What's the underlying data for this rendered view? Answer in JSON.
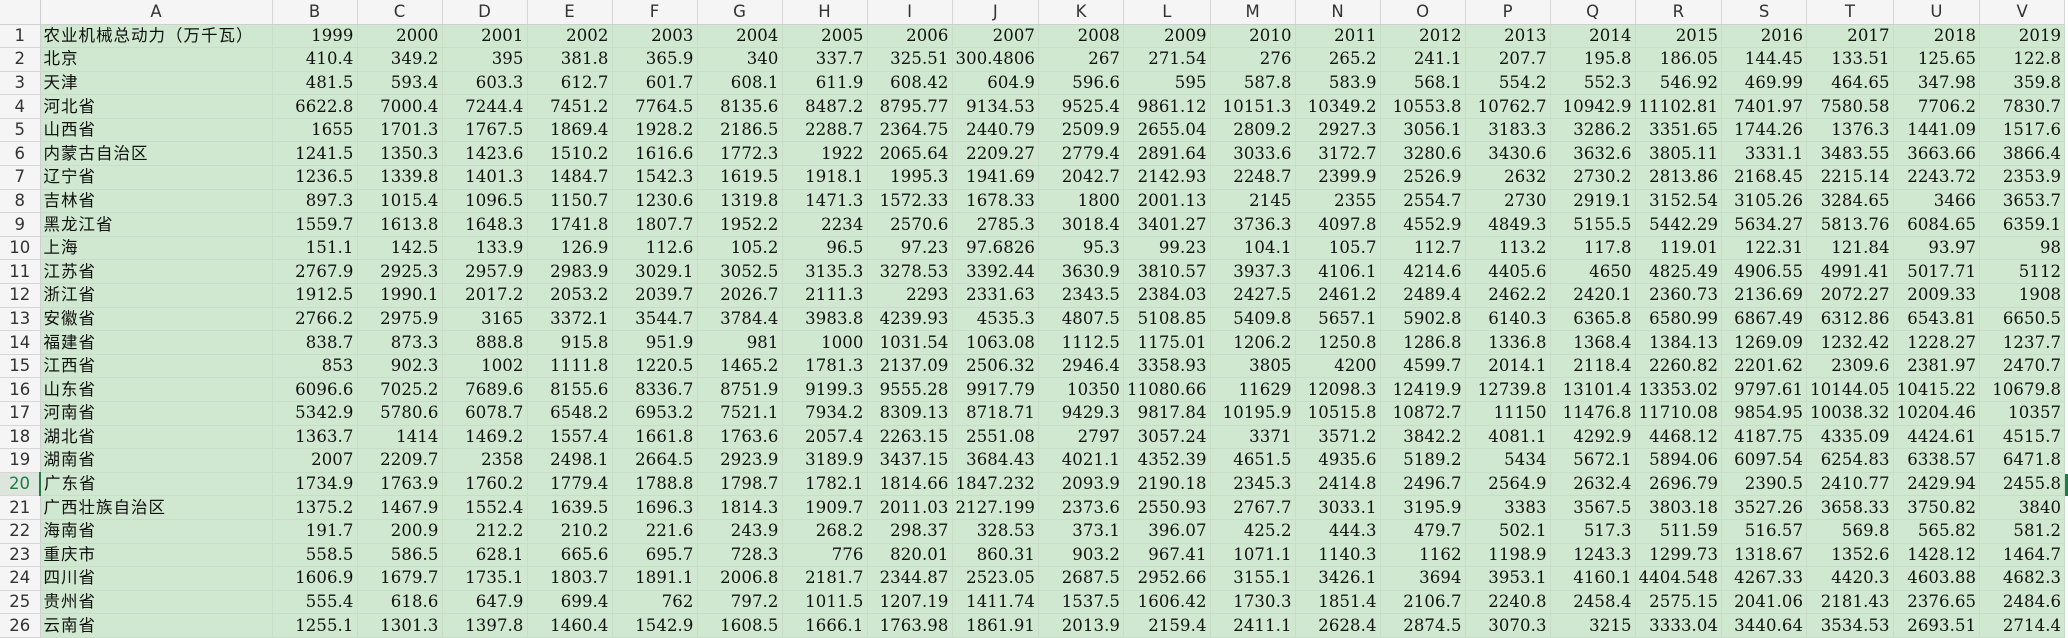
{
  "sheet": {
    "column_headers": [
      "A",
      "B",
      "C",
      "D",
      "E",
      "F",
      "G",
      "H",
      "I",
      "J",
      "K",
      "L",
      "M",
      "N",
      "O",
      "P",
      "Q",
      "R",
      "S",
      "T",
      "U",
      "V"
    ],
    "active_row": 20,
    "header_row": [
      "农业机械总动力（万千瓦）",
      "1999",
      "2000",
      "2001",
      "2002",
      "2003",
      "2004",
      "2005",
      "2006",
      "2007",
      "2008",
      "2009",
      "2010",
      "2011",
      "2012",
      "2013",
      "2014",
      "2015",
      "2016",
      "2017",
      "2018",
      "2019"
    ],
    "rows": [
      {
        "num": "2",
        "cells": [
          "北京",
          "410.4",
          "349.2",
          "395",
          "381.8",
          "365.9",
          "340",
          "337.7",
          "325.51",
          "300.4806",
          "267",
          "271.54",
          "276",
          "265.2",
          "241.1",
          "207.7",
          "195.8",
          "186.05",
          "144.45",
          "133.51",
          "125.65",
          "122.8"
        ]
      },
      {
        "num": "3",
        "cells": [
          "天津",
          "481.5",
          "593.4",
          "603.3",
          "612.7",
          "601.7",
          "608.1",
          "611.9",
          "608.42",
          "604.9",
          "596.6",
          "595",
          "587.8",
          "583.9",
          "568.1",
          "554.2",
          "552.3",
          "546.92",
          "469.99",
          "464.65",
          "347.98",
          "359.8"
        ]
      },
      {
        "num": "4",
        "cells": [
          "河北省",
          "6622.8",
          "7000.4",
          "7244.4",
          "7451.2",
          "7764.5",
          "8135.6",
          "8487.2",
          "8795.77",
          "9134.53",
          "9525.4",
          "9861.12",
          "10151.3",
          "10349.2",
          "10553.8",
          "10762.7",
          "10942.9",
          "11102.81",
          "7401.97",
          "7580.58",
          "7706.2",
          "7830.7"
        ]
      },
      {
        "num": "5",
        "cells": [
          "山西省",
          "1655",
          "1701.3",
          "1767.5",
          "1869.4",
          "1928.2",
          "2186.5",
          "2288.7",
          "2364.75",
          "2440.79",
          "2509.9",
          "2655.04",
          "2809.2",
          "2927.3",
          "3056.1",
          "3183.3",
          "3286.2",
          "3351.65",
          "1744.26",
          "1376.3",
          "1441.09",
          "1517.6"
        ]
      },
      {
        "num": "6",
        "cells": [
          "内蒙古自治区",
          "1241.5",
          "1350.3",
          "1423.6",
          "1510.2",
          "1616.6",
          "1772.3",
          "1922",
          "2065.64",
          "2209.27",
          "2779.4",
          "2891.64",
          "3033.6",
          "3172.7",
          "3280.6",
          "3430.6",
          "3632.6",
          "3805.11",
          "3331.1",
          "3483.55",
          "3663.66",
          "3866.4"
        ]
      },
      {
        "num": "7",
        "cells": [
          "辽宁省",
          "1236.5",
          "1339.8",
          "1401.3",
          "1484.7",
          "1542.3",
          "1619.5",
          "1918.1",
          "1995.3",
          "1941.69",
          "2042.7",
          "2142.93",
          "2248.7",
          "2399.9",
          "2526.9",
          "2632",
          "2730.2",
          "2813.86",
          "2168.45",
          "2215.14",
          "2243.72",
          "2353.9"
        ]
      },
      {
        "num": "8",
        "cells": [
          "吉林省",
          "897.3",
          "1015.4",
          "1096.5",
          "1150.7",
          "1230.6",
          "1319.8",
          "1471.3",
          "1572.33",
          "1678.33",
          "1800",
          "2001.13",
          "2145",
          "2355",
          "2554.7",
          "2730",
          "2919.1",
          "3152.54",
          "3105.26",
          "3284.65",
          "3466",
          "3653.7"
        ]
      },
      {
        "num": "9",
        "cells": [
          "黑龙江省",
          "1559.7",
          "1613.8",
          "1648.3",
          "1741.8",
          "1807.7",
          "1952.2",
          "2234",
          "2570.6",
          "2785.3",
          "3018.4",
          "3401.27",
          "3736.3",
          "4097.8",
          "4552.9",
          "4849.3",
          "5155.5",
          "5442.29",
          "5634.27",
          "5813.76",
          "6084.65",
          "6359.1"
        ]
      },
      {
        "num": "10",
        "cells": [
          "上海",
          "151.1",
          "142.5",
          "133.9",
          "126.9",
          "112.6",
          "105.2",
          "96.5",
          "97.23",
          "97.6826",
          "95.3",
          "99.23",
          "104.1",
          "105.7",
          "112.7",
          "113.2",
          "117.8",
          "119.01",
          "122.31",
          "121.84",
          "93.97",
          "98"
        ]
      },
      {
        "num": "11",
        "cells": [
          "江苏省",
          "2767.9",
          "2925.3",
          "2957.9",
          "2983.9",
          "3029.1",
          "3052.5",
          "3135.3",
          "3278.53",
          "3392.44",
          "3630.9",
          "3810.57",
          "3937.3",
          "4106.1",
          "4214.6",
          "4405.6",
          "4650",
          "4825.49",
          "4906.55",
          "4991.41",
          "5017.71",
          "5112"
        ]
      },
      {
        "num": "12",
        "cells": [
          "浙江省",
          "1912.5",
          "1990.1",
          "2017.2",
          "2053.2",
          "2039.7",
          "2026.7",
          "2111.3",
          "2293",
          "2331.63",
          "2343.5",
          "2384.03",
          "2427.5",
          "2461.2",
          "2489.4",
          "2462.2",
          "2420.1",
          "2360.73",
          "2136.69",
          "2072.27",
          "2009.33",
          "1908"
        ]
      },
      {
        "num": "13",
        "cells": [
          "安徽省",
          "2766.2",
          "2975.9",
          "3165",
          "3372.1",
          "3544.7",
          "3784.4",
          "3983.8",
          "4239.93",
          "4535.3",
          "4807.5",
          "5108.85",
          "5409.8",
          "5657.1",
          "5902.8",
          "6140.3",
          "6365.8",
          "6580.99",
          "6867.49",
          "6312.86",
          "6543.81",
          "6650.5"
        ]
      },
      {
        "num": "14",
        "cells": [
          "福建省",
          "838.7",
          "873.3",
          "888.8",
          "915.8",
          "951.9",
          "981",
          "1000",
          "1031.54",
          "1063.08",
          "1112.5",
          "1175.01",
          "1206.2",
          "1250.8",
          "1286.8",
          "1336.8",
          "1368.4",
          "1384.13",
          "1269.09",
          "1232.42",
          "1228.27",
          "1237.7"
        ]
      },
      {
        "num": "15",
        "cells": [
          "江西省",
          "853",
          "902.3",
          "1002",
          "1111.8",
          "1220.5",
          "1465.2",
          "1781.3",
          "2137.09",
          "2506.32",
          "2946.4",
          "3358.93",
          "3805",
          "4200",
          "4599.7",
          "2014.1",
          "2118.4",
          "2260.82",
          "2201.62",
          "2309.6",
          "2381.97",
          "2470.7"
        ]
      },
      {
        "num": "16",
        "cells": [
          "山东省",
          "6096.6",
          "7025.2",
          "7689.6",
          "8155.6",
          "8336.7",
          "8751.9",
          "9199.3",
          "9555.28",
          "9917.79",
          "10350",
          "11080.66",
          "11629",
          "12098.3",
          "12419.9",
          "12739.8",
          "13101.4",
          "13353.02",
          "9797.61",
          "10144.05",
          "10415.22",
          "10679.8"
        ]
      },
      {
        "num": "17",
        "cells": [
          "河南省",
          "5342.9",
          "5780.6",
          "6078.7",
          "6548.2",
          "6953.2",
          "7521.1",
          "7934.2",
          "8309.13",
          "8718.71",
          "9429.3",
          "9817.84",
          "10195.9",
          "10515.8",
          "10872.7",
          "11150",
          "11476.8",
          "11710.08",
          "9854.95",
          "10038.32",
          "10204.46",
          "10357"
        ]
      },
      {
        "num": "18",
        "cells": [
          "湖北省",
          "1363.7",
          "1414",
          "1469.2",
          "1557.4",
          "1661.8",
          "1763.6",
          "2057.4",
          "2263.15",
          "2551.08",
          "2797",
          "3057.24",
          "3371",
          "3571.2",
          "3842.2",
          "4081.1",
          "4292.9",
          "4468.12",
          "4187.75",
          "4335.09",
          "4424.61",
          "4515.7"
        ]
      },
      {
        "num": "19",
        "cells": [
          "湖南省",
          "2007",
          "2209.7",
          "2358",
          "2498.1",
          "2664.5",
          "2923.9",
          "3189.9",
          "3437.15",
          "3684.43",
          "4021.1",
          "4352.39",
          "4651.5",
          "4935.6",
          "5189.2",
          "5434",
          "5672.1",
          "5894.06",
          "6097.54",
          "6254.83",
          "6338.57",
          "6471.8"
        ]
      },
      {
        "num": "20",
        "cells": [
          "广东省",
          "1734.9",
          "1763.9",
          "1760.2",
          "1779.4",
          "1788.8",
          "1798.7",
          "1782.1",
          "1814.66",
          "1847.232",
          "2093.9",
          "2190.18",
          "2345.3",
          "2414.8",
          "2496.7",
          "2564.9",
          "2632.4",
          "2696.79",
          "2390.5",
          "2410.77",
          "2429.94",
          "2455.8"
        ]
      },
      {
        "num": "21",
        "cells": [
          "广西壮族自治区",
          "1375.2",
          "1467.9",
          "1552.4",
          "1639.5",
          "1696.3",
          "1814.3",
          "1909.7",
          "2011.03",
          "2127.199",
          "2373.6",
          "2550.93",
          "2767.7",
          "3033.1",
          "3195.9",
          "3383",
          "3567.5",
          "3803.18",
          "3527.26",
          "3658.33",
          "3750.82",
          "3840"
        ]
      },
      {
        "num": "22",
        "cells": [
          "海南省",
          "191.7",
          "200.9",
          "212.2",
          "210.2",
          "221.6",
          "243.9",
          "268.2",
          "298.37",
          "328.53",
          "373.1",
          "396.07",
          "425.2",
          "444.3",
          "479.7",
          "502.1",
          "517.3",
          "511.59",
          "516.57",
          "569.8",
          "565.82",
          "581.2"
        ]
      },
      {
        "num": "23",
        "cells": [
          "重庆市",
          "558.5",
          "586.5",
          "628.1",
          "665.6",
          "695.7",
          "728.3",
          "776",
          "820.01",
          "860.31",
          "903.2",
          "967.41",
          "1071.1",
          "1140.3",
          "1162",
          "1198.9",
          "1243.3",
          "1299.73",
          "1318.67",
          "1352.6",
          "1428.12",
          "1464.7"
        ]
      },
      {
        "num": "24",
        "cells": [
          "四川省",
          "1606.9",
          "1679.7",
          "1735.1",
          "1803.7",
          "1891.1",
          "2006.8",
          "2181.7",
          "2344.87",
          "2523.05",
          "2687.5",
          "2952.66",
          "3155.1",
          "3426.1",
          "3694",
          "3953.1",
          "4160.1",
          "4404.548",
          "4267.33",
          "4420.3",
          "4603.88",
          "4682.3"
        ]
      },
      {
        "num": "25",
        "cells": [
          "贵州省",
          "555.4",
          "618.6",
          "647.9",
          "699.4",
          "762",
          "797.2",
          "1011.5",
          "1207.19",
          "1411.74",
          "1537.5",
          "1606.42",
          "1730.3",
          "1851.4",
          "2106.7",
          "2240.8",
          "2458.4",
          "2575.15",
          "2041.06",
          "2181.43",
          "2376.65",
          "2484.6"
        ]
      },
      {
        "num": "26",
        "cells": [
          "云南省",
          "1255.1",
          "1301.3",
          "1397.8",
          "1460.4",
          "1542.9",
          "1608.5",
          "1666.1",
          "1763.98",
          "1861.91",
          "2013.9",
          "2159.4",
          "2411.1",
          "2628.4",
          "2874.5",
          "3070.3",
          "3215",
          "3333.04",
          "3440.64",
          "3534.53",
          "2693.51",
          "2714.4"
        ]
      }
    ]
  }
}
